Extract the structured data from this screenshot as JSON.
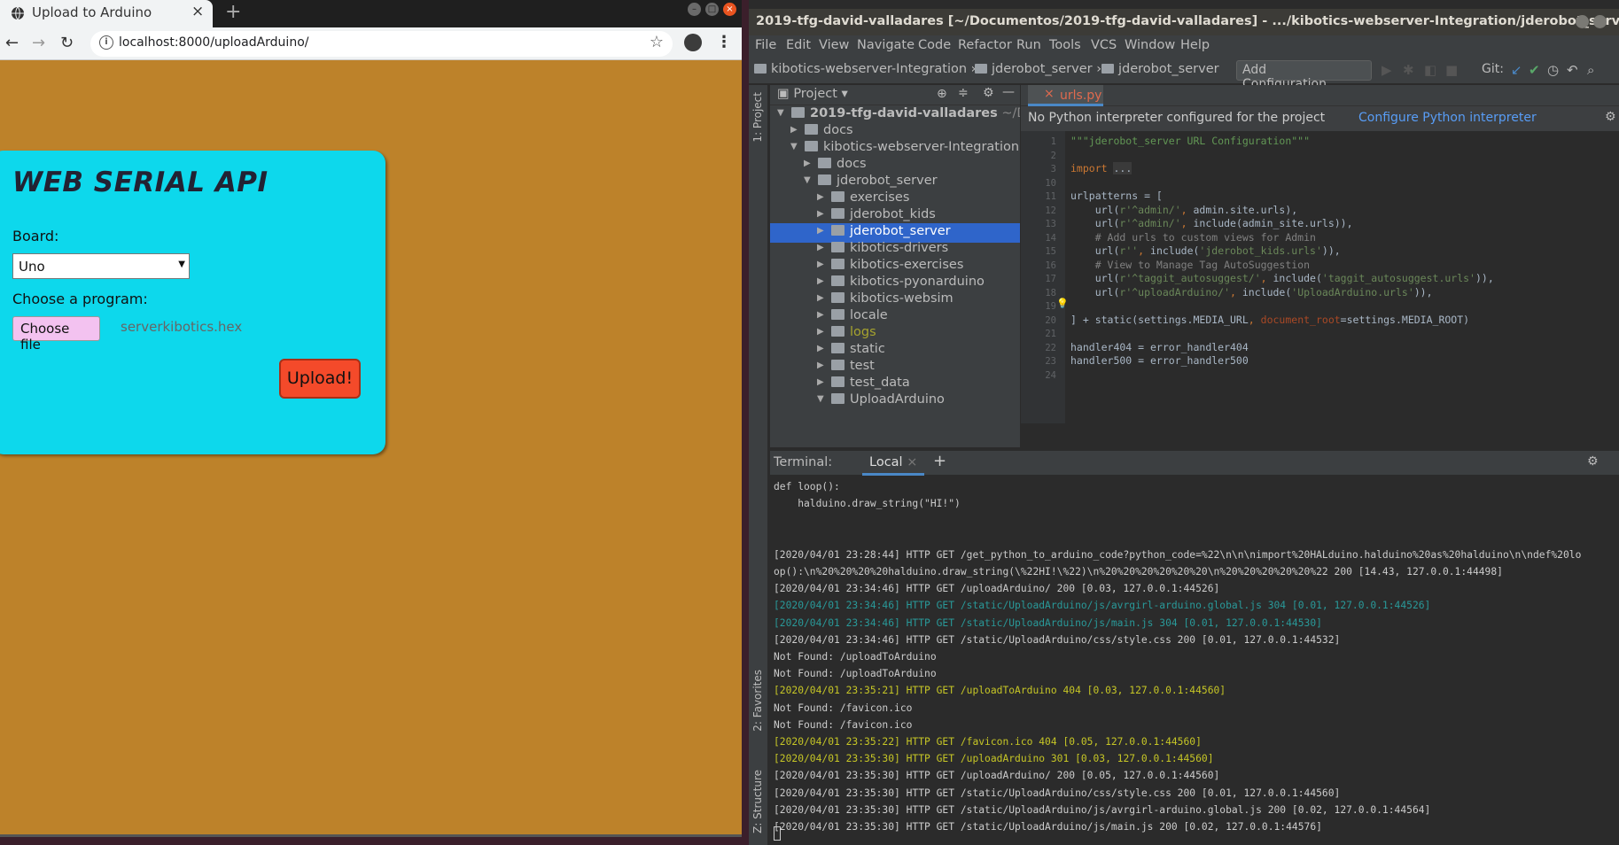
{
  "browser": {
    "tab_title": "Upload to Arduino",
    "tab_close": "×",
    "new_tab": "+",
    "url": "localhost:8000/uploadArduino/",
    "page": {
      "heading": "WEB SERIAL API",
      "board_label": "Board:",
      "board_value": "Uno",
      "program_label": "Choose a program:",
      "choose_file_label": "Choose file",
      "file_name": "serverkibotics.hex",
      "upload_label": "Upload!"
    }
  },
  "ide": {
    "title": "2019-tfg-david-valladares [~/Documentos/2019-tfg-david-valladares] - .../kibotics-webserver-Integration/jderobot_server/jderob...",
    "menu": [
      "File",
      "Edit",
      "View",
      "Navigate",
      "Code",
      "Refactor",
      "Run",
      "Tools",
      "VCS",
      "Window",
      "Help"
    ],
    "breadcrumbs": [
      "kibotics-webserver-Integration",
      "jderobot_server",
      "jderobot_server"
    ],
    "add_configuration": "Add Configuration...",
    "git_label": "Git:",
    "side_tabs": {
      "project": "1: Project",
      "favorites": "2: Favorites",
      "structure": "Z: Structure"
    },
    "project_panel_title": "Project",
    "tree": [
      {
        "label": "2019-tfg-david-valladares",
        "suffix": "~/Documer",
        "depth": 0,
        "expanded": true
      },
      {
        "label": "docs",
        "depth": 1,
        "expanded": false
      },
      {
        "label": "kibotics-webserver-Integration",
        "depth": 1,
        "expanded": true
      },
      {
        "label": "docs",
        "depth": 2,
        "expanded": false
      },
      {
        "label": "jderobot_server",
        "depth": 2,
        "expanded": true
      },
      {
        "label": "exercises",
        "depth": 3,
        "expanded": false
      },
      {
        "label": "jderobot_kids",
        "depth": 3,
        "expanded": false
      },
      {
        "label": "jderobot_server",
        "depth": 3,
        "expanded": false,
        "selected": true
      },
      {
        "label": "kibotics-drivers",
        "depth": 3,
        "expanded": false
      },
      {
        "label": "kibotics-exercises",
        "depth": 3,
        "expanded": false
      },
      {
        "label": "kibotics-pyonarduino",
        "depth": 3,
        "expanded": false
      },
      {
        "label": "kibotics-websim",
        "depth": 3,
        "expanded": false
      },
      {
        "label": "locale",
        "depth": 3,
        "expanded": false
      },
      {
        "label": "logs",
        "depth": 3,
        "expanded": false,
        "color": "#a6a32e"
      },
      {
        "label": "static",
        "depth": 3,
        "expanded": false
      },
      {
        "label": "test",
        "depth": 3,
        "expanded": false
      },
      {
        "label": "test_data",
        "depth": 3,
        "expanded": false
      },
      {
        "label": "UploadArduino",
        "depth": 3,
        "expanded": true
      }
    ],
    "editor_tab": "urls.py",
    "notice": "No Python interpreter configured for the project",
    "notice_action": "Configure Python interpreter",
    "line_numbers": [
      "1",
      "2",
      "3",
      "10",
      "11",
      "12",
      "13",
      "14",
      "15",
      "16",
      "17",
      "18",
      "19",
      "20",
      "21",
      "22",
      "23",
      "24"
    ],
    "code_lines": [
      "\"\"\"jderobot_server URL Configuration\"\"\"",
      "",
      "import ...",
      "",
      "urlpatterns = [",
      "    url(r'^admin/', admin.site.urls),",
      "    url(r'^admin/', include(admin_site.urls)),",
      "    # Add urls to custom views for Admin",
      "    url(r'', include('jderobot_kids.urls')),",
      "    # View to Manage Tag AutoSuggestion",
      "    url(r'^taggit_autosuggest/', include('taggit_autosuggest.urls')),",
      "    url(r'^uploadArduino/', include('UploadArduino.urls')),",
      "",
      "] + static(settings.MEDIA_URL, document_root=settings.MEDIA_ROOT)",
      "",
      "handler404 = error_handler404",
      "handler500 = error_handler500",
      ""
    ],
    "terminal": {
      "title": "Terminal:",
      "tab": "Local",
      "lines": [
        {
          "text": "def loop():",
          "kind": "n"
        },
        {
          "text": "    halduino.draw_string(\"HI!\")",
          "kind": "n"
        },
        {
          "text": "",
          "kind": "n"
        },
        {
          "text": "",
          "kind": "n"
        },
        {
          "text": "[2020/04/01 23:28:44] HTTP GET /get_python_to_arduino_code?python_code=%22\\n\\n\\nimport%20HALduino.halduino%20as%20halduino\\n\\ndef%20lo",
          "kind": "n"
        },
        {
          "text": "op():\\n%20%20%20%20halduino.draw_string(\\%22HI!\\%22)\\n%20%20%20%20%20%20\\n%20%20%20%20%20%22 200 [14.43, 127.0.0.1:44498]",
          "kind": "n"
        },
        {
          "text": "[2020/04/01 23:34:46] HTTP GET /uploadArduino/ 200 [0.03, 127.0.0.1:44526]",
          "kind": "n"
        },
        {
          "text": "[2020/04/01 23:34:46] HTTP GET /static/UploadArduino/js/avrgirl-arduino.global.js 304 [0.01, 127.0.0.1:44526]",
          "kind": "c"
        },
        {
          "text": "[2020/04/01 23:34:46] HTTP GET /static/UploadArduino/js/main.js 304 [0.01, 127.0.0.1:44530]",
          "kind": "c"
        },
        {
          "text": "[2020/04/01 23:34:46] HTTP GET /static/UploadArduino/css/style.css 200 [0.01, 127.0.0.1:44532]",
          "kind": "n"
        },
        {
          "text": "Not Found: /uploadToArduino",
          "kind": "n"
        },
        {
          "text": "Not Found: /uploadToArduino",
          "kind": "n"
        },
        {
          "text": "[2020/04/01 23:35:21] HTTP GET /uploadToArduino 404 [0.03, 127.0.0.1:44560]",
          "kind": "y"
        },
        {
          "text": "Not Found: /favicon.ico",
          "kind": "n"
        },
        {
          "text": "Not Found: /favicon.ico",
          "kind": "n"
        },
        {
          "text": "[2020/04/01 23:35:22] HTTP GET /favicon.ico 404 [0.05, 127.0.0.1:44560]",
          "kind": "y"
        },
        {
          "text": "[2020/04/01 23:35:30] HTTP GET /uploadArduino 301 [0.03, 127.0.0.1:44560]",
          "kind": "y"
        },
        {
          "text": "[2020/04/01 23:35:30] HTTP GET /uploadArduino/ 200 [0.05, 127.0.0.1:44560]",
          "kind": "n"
        },
        {
          "text": "[2020/04/01 23:35:30] HTTP GET /static/UploadArduino/css/style.css 200 [0.01, 127.0.0.1:44560]",
          "kind": "n"
        },
        {
          "text": "[2020/04/01 23:35:30] HTTP GET /static/UploadArduino/js/avrgirl-arduino.global.js 200 [0.02, 127.0.0.1:44564]",
          "kind": "n"
        },
        {
          "text": "[2020/04/01 23:35:30] HTTP GET /static/UploadArduino/js/main.js 200 [0.02, 127.0.0.1:44576]",
          "kind": "n"
        }
      ]
    }
  },
  "colors": {
    "page_bg": "#bd822a",
    "card_bg": "#0dd8ec",
    "upload_btn": "#f44a2a",
    "selection": "#2f65ca"
  }
}
